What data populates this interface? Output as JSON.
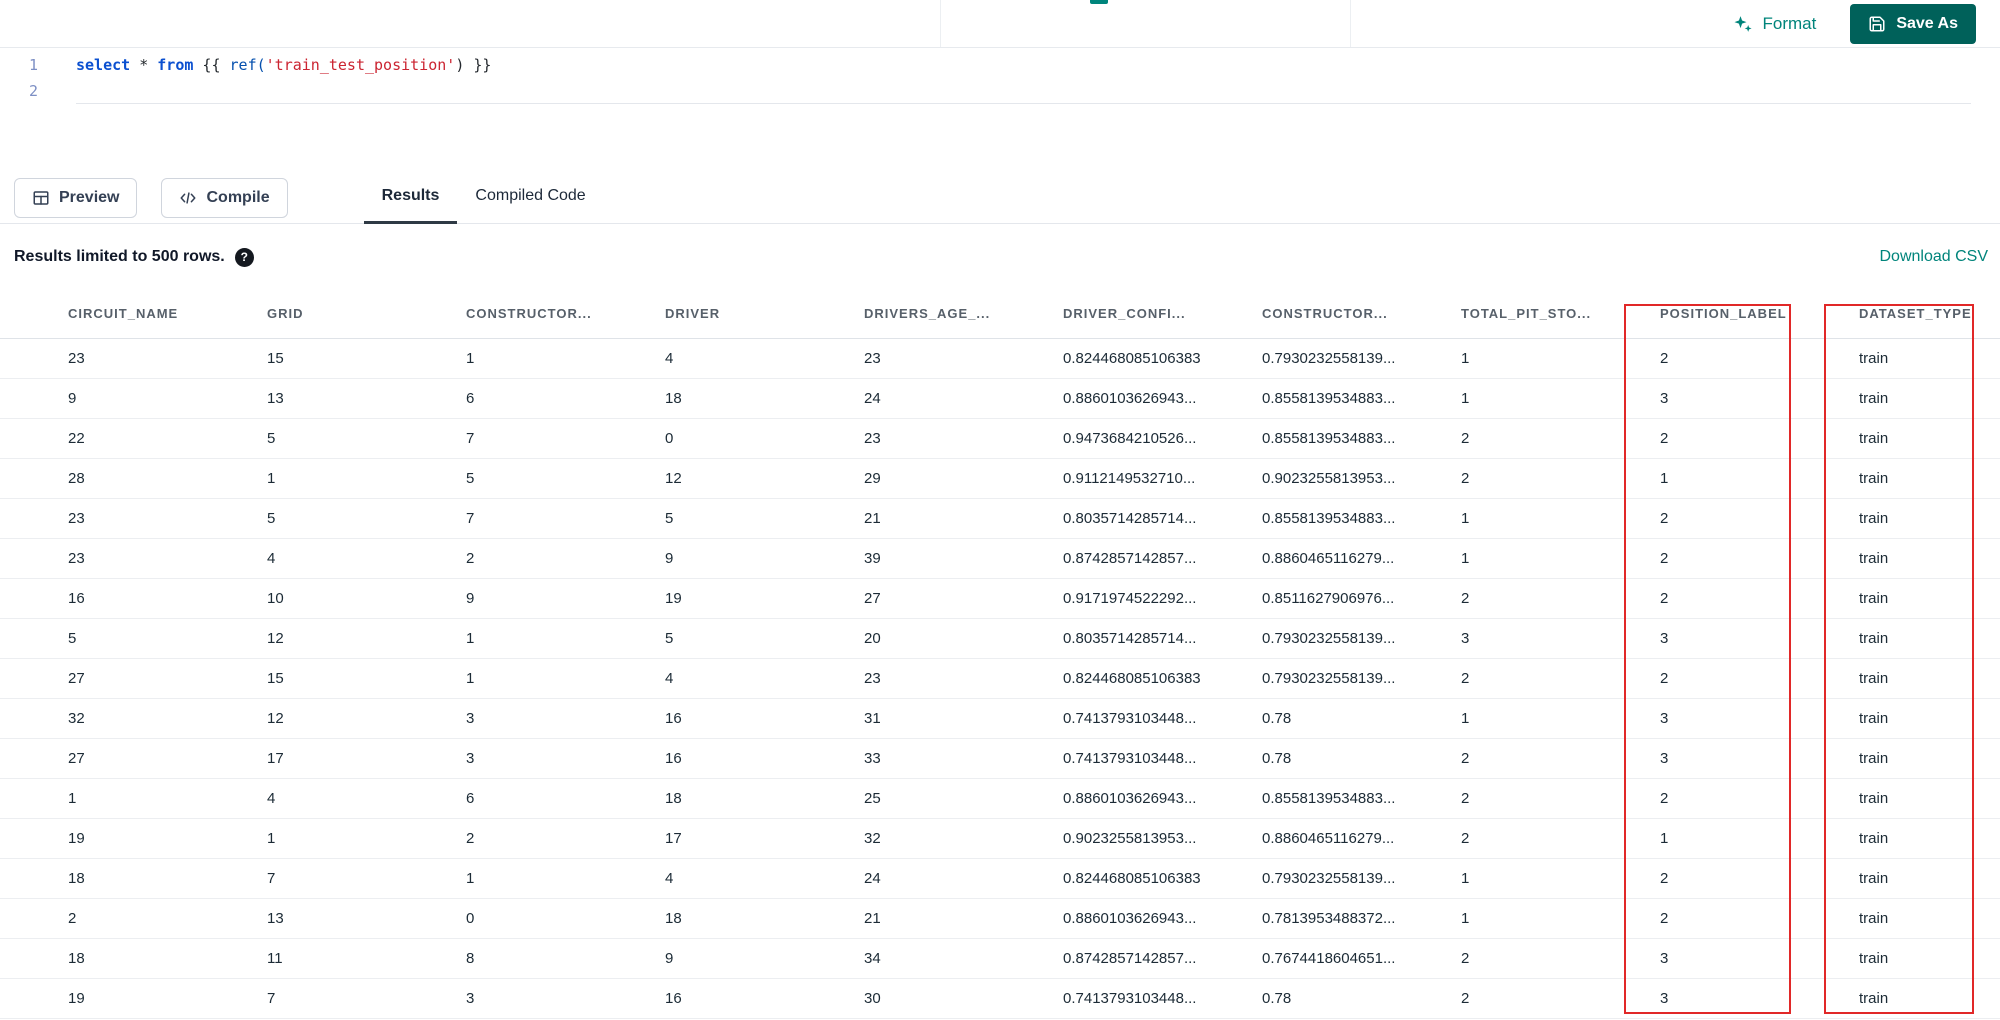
{
  "topbar": {
    "format_label": "Format",
    "save_as_label": "Save As"
  },
  "editor": {
    "line1_number": "1",
    "line2_number": "2",
    "tokens": {
      "kw_select": "select",
      "op_star": " * ",
      "kw_from": "from",
      "jinja_open": " {{ ",
      "fn_ref": "ref(",
      "str_model": "'train_test_position'",
      "jinja_close": ") }}"
    }
  },
  "controls": {
    "preview_label": "Preview",
    "compile_label": "Compile",
    "tabs": [
      {
        "label": "Results",
        "active": true
      },
      {
        "label": "Compiled Code",
        "active": false
      }
    ]
  },
  "results_bar": {
    "limit_text": "Results limited to 500 rows.",
    "help_glyph": "?",
    "download_csv_label": "Download CSV"
  },
  "table": {
    "columns": [
      "CIRCUIT_NAME",
      "GRID",
      "CONSTRUCTOR...",
      "DRIVER",
      "DRIVERS_AGE_...",
      "DRIVER_CONFI...",
      "CONSTRUCTOR...",
      "TOTAL_PIT_STO...",
      "POSITION_LABEL",
      "DATASET_TYPE"
    ],
    "highlighted_columns": [
      "POSITION_LABEL",
      "DATASET_TYPE"
    ],
    "rows": [
      [
        "23",
        "15",
        "1",
        "4",
        "23",
        "0.824468085106383",
        "0.7930232558139...",
        "1",
        "2",
        "train"
      ],
      [
        "9",
        "13",
        "6",
        "18",
        "24",
        "0.8860103626943...",
        "0.8558139534883...",
        "1",
        "3",
        "train"
      ],
      [
        "22",
        "5",
        "7",
        "0",
        "23",
        "0.9473684210526...",
        "0.8558139534883...",
        "2",
        "2",
        "train"
      ],
      [
        "28",
        "1",
        "5",
        "12",
        "29",
        "0.9112149532710...",
        "0.9023255813953...",
        "2",
        "1",
        "train"
      ],
      [
        "23",
        "5",
        "7",
        "5",
        "21",
        "0.8035714285714...",
        "0.8558139534883...",
        "1",
        "2",
        "train"
      ],
      [
        "23",
        "4",
        "2",
        "9",
        "39",
        "0.8742857142857...",
        "0.8860465116279...",
        "1",
        "2",
        "train"
      ],
      [
        "16",
        "10",
        "9",
        "19",
        "27",
        "0.9171974522292...",
        "0.8511627906976...",
        "2",
        "2",
        "train"
      ],
      [
        "5",
        "12",
        "1",
        "5",
        "20",
        "0.8035714285714...",
        "0.7930232558139...",
        "3",
        "3",
        "train"
      ],
      [
        "27",
        "15",
        "1",
        "4",
        "23",
        "0.824468085106383",
        "0.7930232558139...",
        "2",
        "2",
        "train"
      ],
      [
        "32",
        "12",
        "3",
        "16",
        "31",
        "0.7413793103448...",
        "0.78",
        "1",
        "3",
        "train"
      ],
      [
        "27",
        "17",
        "3",
        "16",
        "33",
        "0.7413793103448...",
        "0.78",
        "2",
        "3",
        "train"
      ],
      [
        "1",
        "4",
        "6",
        "18",
        "25",
        "0.8860103626943...",
        "0.8558139534883...",
        "2",
        "2",
        "train"
      ],
      [
        "19",
        "1",
        "2",
        "17",
        "32",
        "0.9023255813953...",
        "0.8860465116279...",
        "2",
        "1",
        "train"
      ],
      [
        "18",
        "7",
        "1",
        "4",
        "24",
        "0.824468085106383",
        "0.7930232558139...",
        "1",
        "2",
        "train"
      ],
      [
        "2",
        "13",
        "0",
        "18",
        "21",
        "0.8860103626943...",
        "0.7813953488372...",
        "1",
        "2",
        "train"
      ],
      [
        "18",
        "11",
        "8",
        "9",
        "34",
        "0.8742857142857...",
        "0.7674418604651...",
        "2",
        "3",
        "train"
      ],
      [
        "19",
        "7",
        "3",
        "16",
        "30",
        "0.7413793103448...",
        "0.78",
        "2",
        "3",
        "train"
      ]
    ]
  },
  "colors": {
    "accent_teal": "#00847b",
    "save_button_teal": "#00615a",
    "highlight_red": "#e12828",
    "active_tab_underline": "#2f3a45"
  }
}
